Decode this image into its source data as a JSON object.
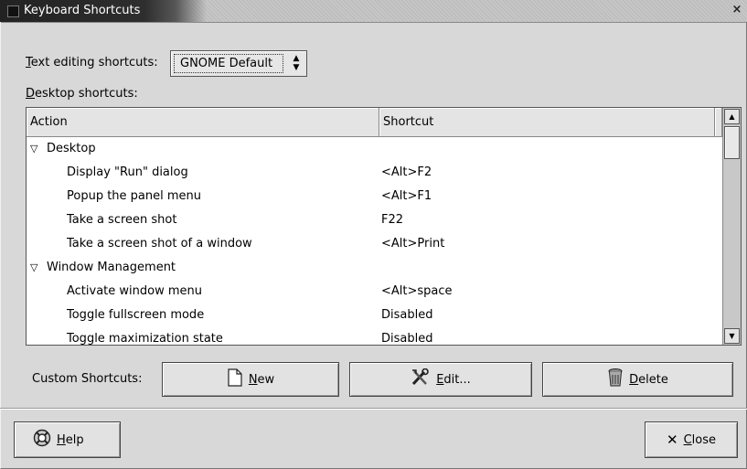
{
  "window": {
    "title": "Keyboard Shortcuts",
    "close_glyph": "×"
  },
  "text_editing": {
    "label": "Text editing shortcuts:",
    "mnemonic": "T",
    "label_rest": "ext editing shortcuts:",
    "value": "GNOME Default"
  },
  "desktop_shortcuts": {
    "label": "Desktop shortcuts:",
    "mnemonic": "D",
    "label_rest": "esktop shortcuts:"
  },
  "tree": {
    "columns": {
      "action": "Action",
      "shortcut": "Shortcut"
    },
    "rows": [
      {
        "kind": "group",
        "action": "Desktop",
        "shortcut": ""
      },
      {
        "kind": "child",
        "action": "Display \"Run\" dialog",
        "shortcut": "<Alt>F2"
      },
      {
        "kind": "child",
        "action": "Popup the panel menu",
        "shortcut": "<Alt>F1"
      },
      {
        "kind": "child",
        "action": "Take a screen shot",
        "shortcut": "F22"
      },
      {
        "kind": "child",
        "action": "Take a screen shot of a window",
        "shortcut": "<Alt>Print"
      },
      {
        "kind": "group",
        "action": "Window Management",
        "shortcut": ""
      },
      {
        "kind": "child",
        "action": "Activate window menu",
        "shortcut": "<Alt>space"
      },
      {
        "kind": "child",
        "action": "Toggle fullscreen mode",
        "shortcut": "Disabled"
      },
      {
        "kind": "child",
        "action": "Toggle maximization state",
        "shortcut": "Disabled"
      }
    ],
    "scroll_position": 0.0
  },
  "custom": {
    "label": "Custom Shortcuts:",
    "new": {
      "mnemonic": "N",
      "rest": "ew",
      "icon": "new-document-icon"
    },
    "edit": {
      "mnemonic": "E",
      "rest": "dit...",
      "icon": "tools-icon"
    },
    "delete": {
      "mnemonic": "D",
      "rest": "elete",
      "icon": "trash-icon"
    }
  },
  "footer": {
    "help": {
      "mnemonic": "H",
      "rest": "elp",
      "icon": "lifebuoy-help-icon"
    },
    "close": {
      "mnemonic": "C",
      "rest": "lose",
      "icon": "close-x-icon"
    }
  }
}
